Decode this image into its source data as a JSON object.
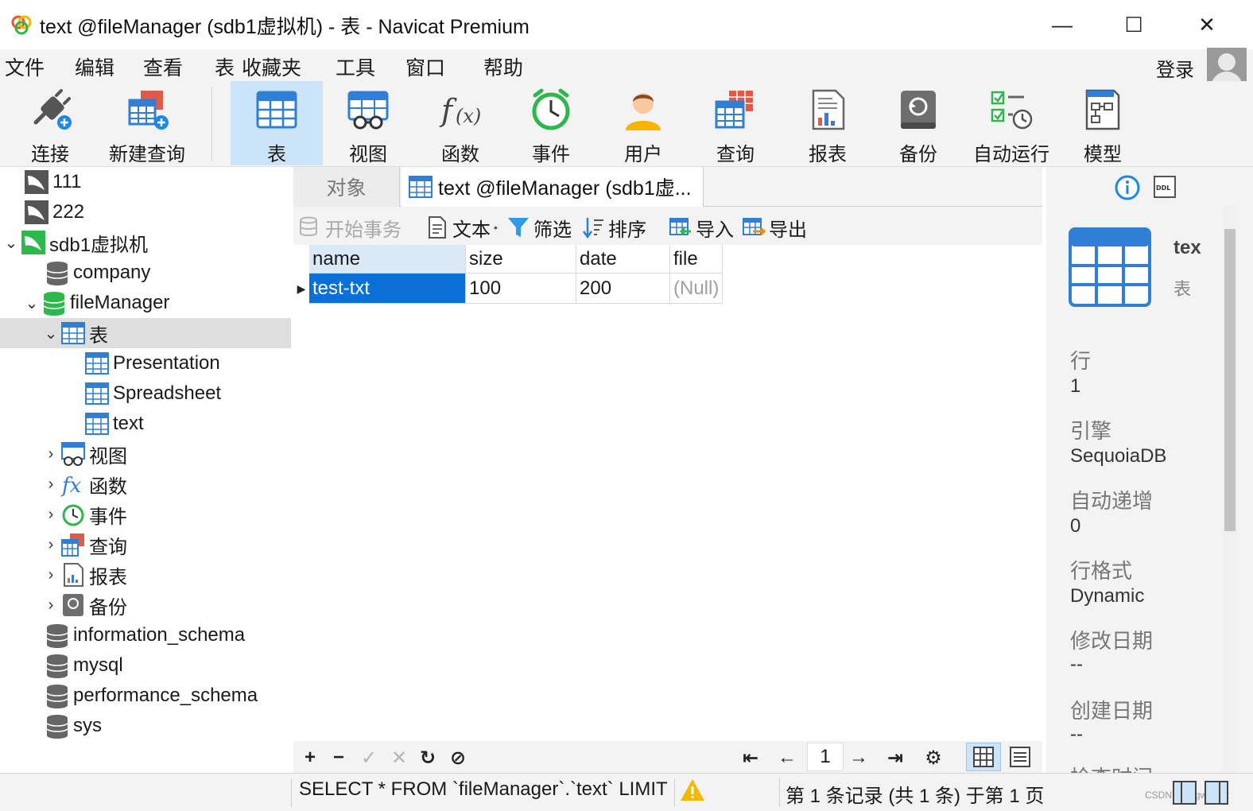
{
  "window": {
    "title": "text @fileManager (sdb1虚拟机) - 表 - Navicat Premium",
    "minimize_glyph": "—",
    "maximize_glyph": "☐",
    "close_glyph": "✕"
  },
  "menu": {
    "items": [
      "文件",
      "编辑",
      "查看",
      "表",
      "收藏夹",
      "工具",
      "窗口",
      "帮助"
    ],
    "login": "登录"
  },
  "toolbar": {
    "items": [
      {
        "label": "连接",
        "icon": "plug-icon"
      },
      {
        "label": "新建查询",
        "icon": "new-query-icon"
      },
      {
        "label": "表",
        "icon": "table-icon",
        "active": true
      },
      {
        "label": "视图",
        "icon": "view-icon"
      },
      {
        "label": "函数",
        "icon": "function-icon"
      },
      {
        "label": "事件",
        "icon": "clock-icon"
      },
      {
        "label": "用户",
        "icon": "user-icon"
      },
      {
        "label": "查询",
        "icon": "query-icon"
      },
      {
        "label": "报表",
        "icon": "report-icon"
      },
      {
        "label": "备份",
        "icon": "backup-icon"
      },
      {
        "label": "自动运行",
        "icon": "schedule-icon"
      },
      {
        "label": "模型",
        "icon": "model-icon"
      }
    ]
  },
  "navigator": {
    "nodes": [
      {
        "label": "111"
      },
      {
        "label": "222"
      },
      {
        "label": "sdb1虚拟机",
        "chevron": "⌄"
      },
      {
        "label": "company"
      },
      {
        "label": "fileManager",
        "chevron": "⌄"
      },
      {
        "label": "表",
        "chevron": "⌄"
      },
      {
        "label": "Presentation"
      },
      {
        "label": "Spreadsheet"
      },
      {
        "label": "text"
      },
      {
        "label": "视图",
        "chevron": "›"
      },
      {
        "label": "函数",
        "chevron": "›"
      },
      {
        "label": "事件",
        "chevron": "›"
      },
      {
        "label": "查询",
        "chevron": "›"
      },
      {
        "label": "报表",
        "chevron": "›"
      },
      {
        "label": "备份",
        "chevron": "›"
      },
      {
        "label": "information_schema"
      },
      {
        "label": "mysql"
      },
      {
        "label": "performance_schema"
      },
      {
        "label": "sys"
      }
    ]
  },
  "tabs": {
    "objects": "对象",
    "active": "text @fileManager (sdb1虚..."
  },
  "subtoolbar": {
    "begin_transaction": "开始事务",
    "text": "文本",
    "filter": "筛选",
    "sort": "排序",
    "import": "导入",
    "export": "导出"
  },
  "grid": {
    "columns": [
      "name",
      "size",
      "date",
      "file"
    ],
    "rows": [
      [
        "test-txt",
        "100",
        "200",
        "(Null)"
      ]
    ]
  },
  "gridnav": {
    "add": "+",
    "remove": "−",
    "apply": "✓",
    "discard": "✕",
    "refresh": "↻",
    "stop": "⊘",
    "first": "⇤",
    "prev": "←",
    "page": "1",
    "next": "→",
    "last": "⇥",
    "settings": "⚙"
  },
  "info": {
    "name": "tex",
    "type": "表",
    "fields": [
      {
        "label": "行",
        "value": "1"
      },
      {
        "label": "引擎",
        "value": "SequoiaDB"
      },
      {
        "label": "自动递增",
        "value": "0"
      },
      {
        "label": "行格式",
        "value": "Dynamic"
      },
      {
        "label": "修改日期",
        "value": "--"
      },
      {
        "label": "创建日期",
        "value": "--"
      },
      {
        "label": "检查时间",
        "value": ""
      }
    ]
  },
  "status": {
    "sql": "SELECT * FROM `fileManager`.`text` LIMIT",
    "records": "第 1 条记录 (共 1 条) 于第 1 页",
    "watermark": "CSDN @bugwuwuz"
  },
  "colors": {
    "accent": "#0a6fd6",
    "active_tab_bg": "#cce4f7",
    "navicat_green": "#2db84c",
    "table_blue": "#2f7fd6"
  }
}
